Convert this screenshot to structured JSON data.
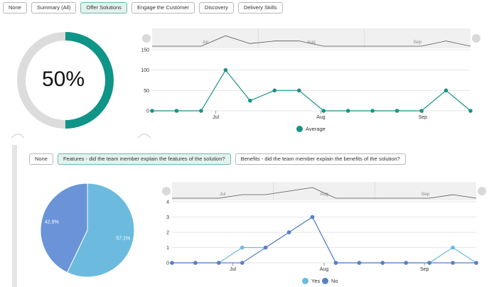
{
  "tabs": [
    {
      "label": "None",
      "active": false
    },
    {
      "label": "Summary (All)",
      "active": false
    },
    {
      "label": "Offer Solutions",
      "active": true
    },
    {
      "label": "Engage the Customer",
      "active": false
    },
    {
      "label": "Discovery",
      "active": false
    },
    {
      "label": "Delivery Skills",
      "active": false
    }
  ],
  "gauge": {
    "value_text": "50%",
    "value": 0.5,
    "color": "#0f9488",
    "track_color": "#dcdcdc"
  },
  "sub_tabs": [
    {
      "label": "None",
      "active": false
    },
    {
      "label": "Features - did the team member explain the features of the solution?",
      "active": true
    },
    {
      "label": "Benefits - did the team member explain the benefits of the solution?",
      "active": false
    }
  ],
  "chart_data": [
    {
      "type": "line",
      "y_ticks": [
        "150",
        "100",
        "50",
        "0"
      ],
      "ylim": [
        0,
        150
      ],
      "x_ticks": [
        "Jul",
        "Aug",
        "Sep"
      ],
      "navigator_labels": [
        "Jul",
        "Aug",
        "Sep"
      ],
      "series": [
        {
          "name": "Average",
          "color": "#1a9287",
          "values": [
            0,
            0,
            0,
            100,
            25,
            50,
            50,
            0,
            0,
            0,
            0,
            0,
            50,
            0
          ]
        }
      ]
    },
    {
      "type": "pie",
      "slices": [
        {
          "name": "Yes",
          "value": 57.1,
          "label": "57.1%",
          "color": "#6cbbdf"
        },
        {
          "name": "No",
          "value": 42.9,
          "label": "42.9%",
          "color": "#6a93d8"
        }
      ]
    },
    {
      "type": "line",
      "y_ticks": [
        "4",
        "3",
        "2",
        "1",
        "0"
      ],
      "ylim": [
        0,
        4
      ],
      "x_ticks": [
        "Jul",
        "Aug",
        "Sep"
      ],
      "navigator_labels": [
        "Jul",
        "Aug",
        "Sep"
      ],
      "series": [
        {
          "name": "Yes",
          "color": "#6cbbdf",
          "values": [
            0,
            0,
            0,
            1,
            1,
            2,
            3,
            0,
            0,
            0,
            0,
            0,
            1,
            0
          ]
        },
        {
          "name": "No",
          "color": "#5a7fc4",
          "values": [
            0,
            0,
            0,
            0,
            1,
            2,
            3,
            0,
            0,
            0,
            0,
            0,
            0,
            0
          ]
        }
      ]
    }
  ]
}
